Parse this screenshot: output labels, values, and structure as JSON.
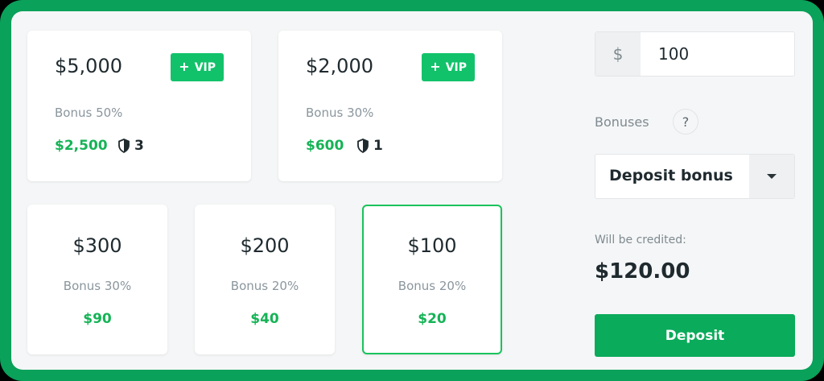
{
  "vip_packages": [
    {
      "amount": "$5,000",
      "badge": "VIP",
      "bonus": "Bonus 50%",
      "bonus_value": "$2,500",
      "count": "3"
    },
    {
      "amount": "$2,000",
      "badge": "VIP",
      "bonus": "Bonus 30%",
      "bonus_value": "$600",
      "count": "1"
    }
  ],
  "packages": [
    {
      "amount": "$300",
      "bonus": "Bonus 30%",
      "bonus_value": "$90"
    },
    {
      "amount": "$200",
      "bonus": "Bonus 20%",
      "bonus_value": "$40"
    },
    {
      "amount": "$100",
      "bonus": "Bonus 20%",
      "bonus_value": "$20"
    }
  ],
  "form": {
    "currency_symbol": "$",
    "amount_value": "100",
    "bonuses_label": "Bonuses",
    "help": "?",
    "bonus_select": "Deposit bonus",
    "credited_label": "Will be credited:",
    "credited_value": "$120.00",
    "deposit_label": "Deposit"
  },
  "colors": {
    "accent": "#0aab5b",
    "bonus_green": "#15b356",
    "border_green": "#0aa15a",
    "selected_border": "#19c35c"
  },
  "icons": {
    "vip_plus": "plus-icon",
    "shield": "shield-icon",
    "dropdown": "caret-down-icon"
  }
}
